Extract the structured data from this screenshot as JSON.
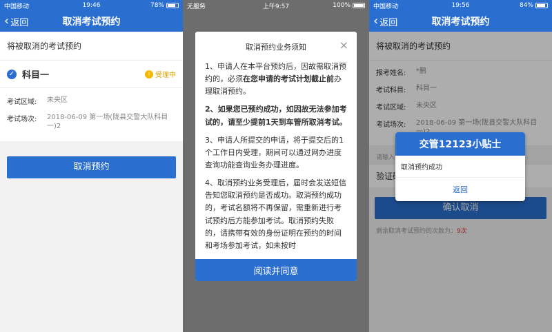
{
  "colors": {
    "primary": "#2a6fcf",
    "pending": "#f5b800",
    "overlay": "#6d6d6d"
  },
  "screen1": {
    "status": {
      "carrier": "中国移动",
      "time": "19:46",
      "battery": "78%",
      "battery_level": 0.78
    },
    "nav": {
      "back": "返回",
      "title": "取消考试预约"
    },
    "section_label": "将被取消的考试预约",
    "subject": {
      "name": "科目一",
      "status": "受理中"
    },
    "fields": [
      {
        "k": "考试区域:",
        "v": "未央区"
      },
      {
        "k": "考试场次:",
        "v": "2018-06-09 第一场(陇县交警大队科目一)2"
      }
    ],
    "cancel_button": "取消预约"
  },
  "screen2": {
    "status": {
      "carrier": "无服务",
      "time": "上午9:57",
      "battery": "100%",
      "battery_level": 1.0
    },
    "modal_title": "取消预约业务须知",
    "close": "×",
    "p1_a": "1、申请人在本平台预约后，因故需取消预约的，必须",
    "p1_b": "在您申请的考试计划截止前",
    "p1_c": "办理取消预约。",
    "p2": "2、如果您已预约成功，如因故无法参加考试的，请至少提前1天到车管所取消考试。",
    "p3": "3、申请人所提交的申请，将于提交后的1个工作日内受理，期间可以通过网办进度查询功能查询业务办理进度。",
    "p4": "4、取消预约业务受理后，届时会发送短信告知您取消预约是否成功。取消预约成功的，考试名额将不再保留，需重新进行考试预约后方能参加考试。取消预约失败的，请携带有效的身份证明在预约的时间和考场参加考试，如未按时",
    "agree_button": "阅读并同意"
  },
  "screen3": {
    "status": {
      "carrier": "中国移动",
      "time": "19:56",
      "battery": "84%",
      "battery_level": 0.84
    },
    "nav": {
      "back": "返回",
      "title": "取消考试预约"
    },
    "section_label": "将被取消的考试预约",
    "fields": [
      {
        "k": "报考姓名:",
        "v": "*鹏"
      },
      {
        "k": "考试科目:",
        "v": "科目一"
      },
      {
        "k": "考试区域:",
        "v": "未央区"
      },
      {
        "k": "考试场次:",
        "v": "2018-06-09 第一场(陇县交警大队科目一)2"
      }
    ],
    "input_hint": "请输入",
    "verify_label": "验证码",
    "confirm_button": "确认取消",
    "note_prefix": "剩余取消考试预约的次数为：",
    "note_count": "9次",
    "toast": {
      "title": "交管12123小贴士",
      "message": "取消预约成功",
      "back": "返回"
    }
  }
}
